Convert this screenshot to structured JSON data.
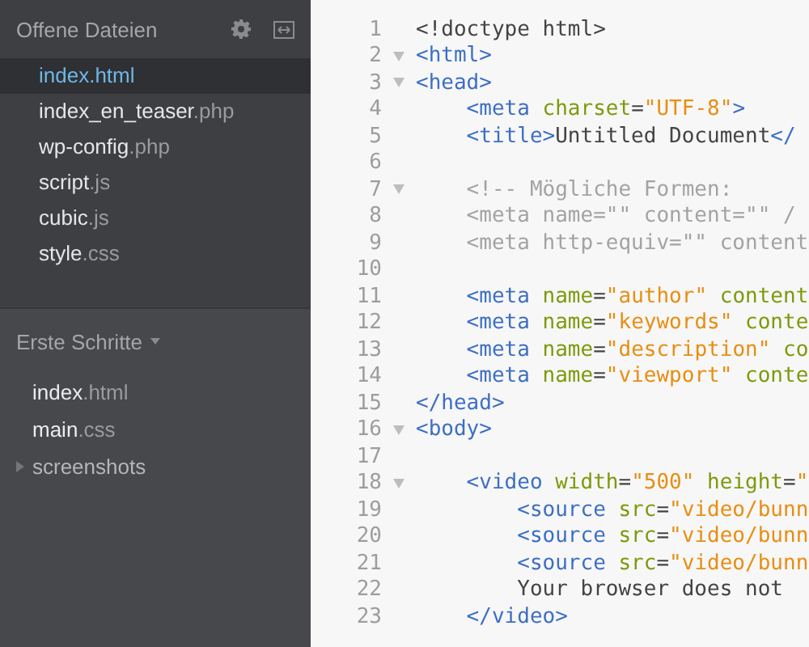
{
  "sidebar": {
    "open_files": {
      "title": "Offene Dateien",
      "files": [
        {
          "name": "index",
          "ext": ".html",
          "selected": true
        },
        {
          "name": "index_en_teaser",
          "ext": ".php",
          "selected": false
        },
        {
          "name": "wp-config",
          "ext": ".php",
          "selected": false
        },
        {
          "name": "script",
          "ext": ".js",
          "selected": false
        },
        {
          "name": "cubic",
          "ext": ".js",
          "selected": false
        },
        {
          "name": "style",
          "ext": ".css",
          "selected": false
        }
      ]
    },
    "project": {
      "title": "Erste Schritte",
      "items": [
        {
          "kind": "file",
          "name": "index",
          "ext": ".html"
        },
        {
          "kind": "file",
          "name": "main",
          "ext": ".css"
        },
        {
          "kind": "folder",
          "name": "screenshots",
          "expanded": false
        }
      ]
    }
  },
  "editor": {
    "lines": [
      {
        "number": "1",
        "fold": false,
        "tokens": [
          {
            "kind": "plain",
            "text": "<!doctype html>"
          }
        ]
      },
      {
        "number": "2",
        "fold": true,
        "tokens": [
          {
            "kind": "tag",
            "text": "<html>"
          }
        ]
      },
      {
        "number": "3",
        "fold": true,
        "tokens": [
          {
            "kind": "tag",
            "text": "<head>"
          }
        ]
      },
      {
        "number": "4",
        "fold": false,
        "tokens": [
          {
            "kind": "tag",
            "text": "    <meta"
          },
          {
            "kind": "attr",
            "text": " charset"
          },
          {
            "kind": "plain",
            "text": "="
          },
          {
            "kind": "string",
            "text": "\"UTF-8\""
          },
          {
            "kind": "tag",
            "text": ">"
          }
        ]
      },
      {
        "number": "5",
        "fold": false,
        "tokens": [
          {
            "kind": "tag",
            "text": "    <title>"
          },
          {
            "kind": "plain",
            "text": "Untitled Document"
          },
          {
            "kind": "tag",
            "text": "</"
          }
        ]
      },
      {
        "number": "6",
        "fold": false
      },
      {
        "number": "7",
        "fold": true,
        "tokens": [
          {
            "kind": "comment",
            "text": "    <!-- Mögliche Formen:"
          }
        ]
      },
      {
        "number": "8",
        "fold": false,
        "tokens": [
          {
            "kind": "comment",
            "text": "    <meta name=\"\" content=\"\" /"
          }
        ]
      },
      {
        "number": "9",
        "fold": false,
        "tokens": [
          {
            "kind": "comment",
            "text": "    <meta http-equiv=\"\" content"
          }
        ]
      },
      {
        "number": "10",
        "fold": false
      },
      {
        "number": "11",
        "fold": false,
        "tokens": [
          {
            "kind": "tag",
            "text": "    <meta"
          },
          {
            "kind": "attr",
            "text": " name"
          },
          {
            "kind": "plain",
            "text": "="
          },
          {
            "kind": "string",
            "text": "\"author\""
          },
          {
            "kind": "attr",
            "text": " content"
          }
        ]
      },
      {
        "number": "12",
        "fold": false,
        "tokens": [
          {
            "kind": "tag",
            "text": "    <meta"
          },
          {
            "kind": "attr",
            "text": " name"
          },
          {
            "kind": "plain",
            "text": "="
          },
          {
            "kind": "string",
            "text": "\"keywords\""
          },
          {
            "kind": "attr",
            "text": " conte"
          }
        ]
      },
      {
        "number": "13",
        "fold": false,
        "tokens": [
          {
            "kind": "tag",
            "text": "    <meta"
          },
          {
            "kind": "attr",
            "text": " name"
          },
          {
            "kind": "plain",
            "text": "="
          },
          {
            "kind": "string",
            "text": "\"description\""
          },
          {
            "kind": "attr",
            "text": " co"
          }
        ]
      },
      {
        "number": "14",
        "fold": false,
        "tokens": [
          {
            "kind": "tag",
            "text": "    <meta"
          },
          {
            "kind": "attr",
            "text": " name"
          },
          {
            "kind": "plain",
            "text": "="
          },
          {
            "kind": "string",
            "text": "\"viewport\""
          },
          {
            "kind": "attr",
            "text": " conte"
          }
        ]
      },
      {
        "number": "15",
        "fold": false,
        "tokens": [
          {
            "kind": "tag",
            "text": "</head>"
          }
        ]
      },
      {
        "number": "16",
        "fold": true,
        "tokens": [
          {
            "kind": "tag",
            "text": "<body>"
          }
        ]
      },
      {
        "number": "17",
        "fold": false
      },
      {
        "number": "18",
        "fold": true,
        "tokens": [
          {
            "kind": "tag",
            "text": "    <video"
          },
          {
            "kind": "attr",
            "text": " width"
          },
          {
            "kind": "plain",
            "text": "="
          },
          {
            "kind": "string",
            "text": "\"500\""
          },
          {
            "kind": "attr",
            "text": " height"
          },
          {
            "kind": "plain",
            "text": "="
          },
          {
            "kind": "string",
            "text": "\""
          }
        ]
      },
      {
        "number": "19",
        "fold": false,
        "tokens": [
          {
            "kind": "tag",
            "text": "        <source"
          },
          {
            "kind": "attr",
            "text": " src"
          },
          {
            "kind": "plain",
            "text": "="
          },
          {
            "kind": "string",
            "text": "\"video/bunn"
          }
        ]
      },
      {
        "number": "20",
        "fold": false,
        "tokens": [
          {
            "kind": "tag",
            "text": "        <source"
          },
          {
            "kind": "attr",
            "text": " src"
          },
          {
            "kind": "plain",
            "text": "="
          },
          {
            "kind": "string",
            "text": "\"video/bunn"
          }
        ]
      },
      {
        "number": "21",
        "fold": false,
        "tokens": [
          {
            "kind": "tag",
            "text": "        <source"
          },
          {
            "kind": "attr",
            "text": " src"
          },
          {
            "kind": "plain",
            "text": "="
          },
          {
            "kind": "string",
            "text": "\"video/bunn"
          }
        ]
      },
      {
        "number": "22",
        "fold": false,
        "tokens": [
          {
            "kind": "plain",
            "text": "        Your browser does not"
          }
        ]
      },
      {
        "number": "23",
        "fold": false,
        "tokens": [
          {
            "kind": "tag",
            "text": "    </video>"
          }
        ]
      }
    ]
  }
}
